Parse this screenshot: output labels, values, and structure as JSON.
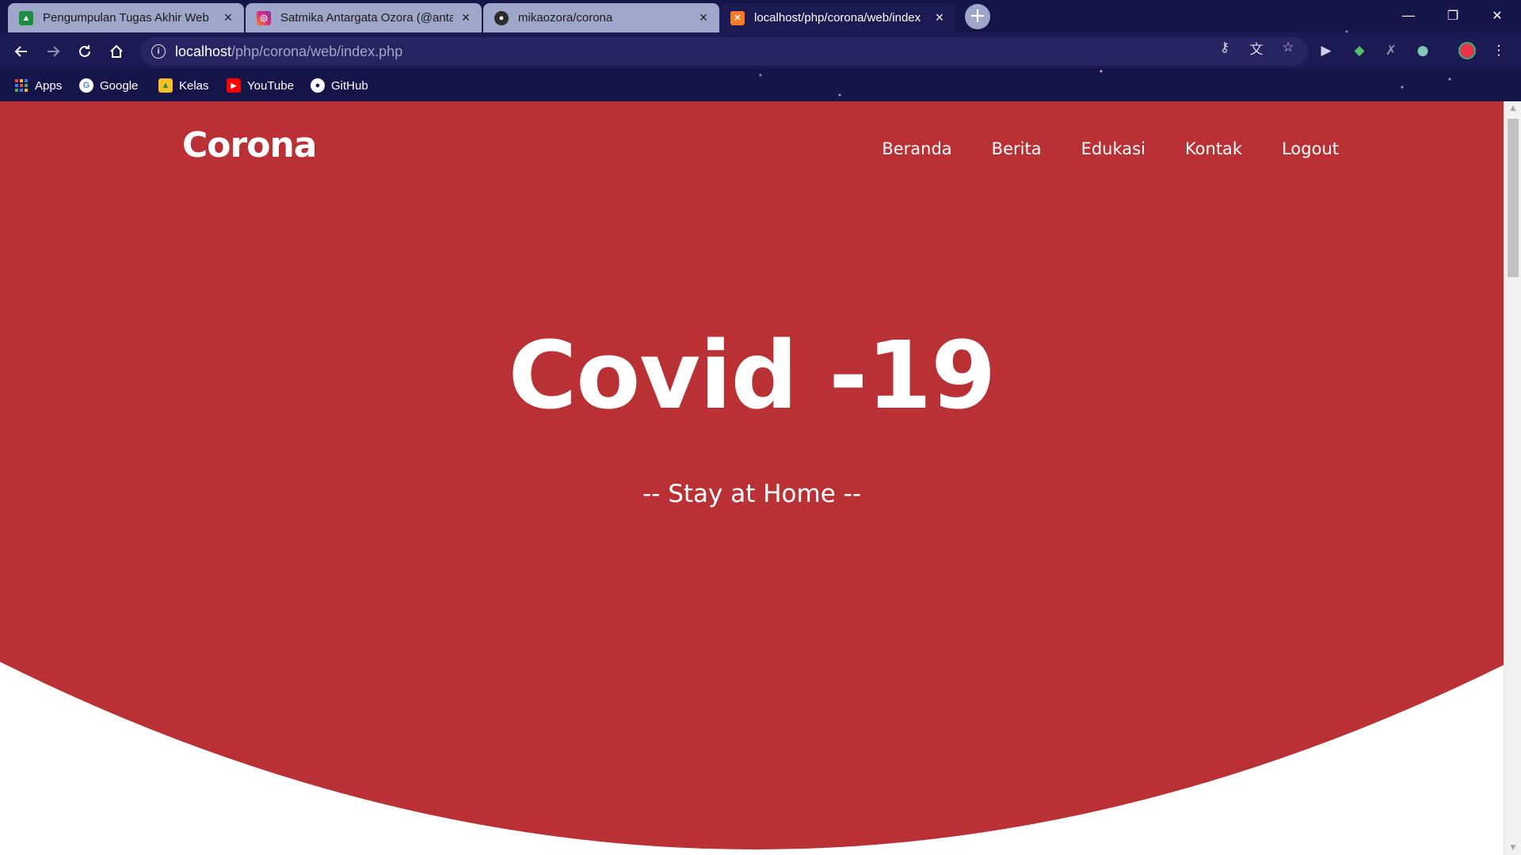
{
  "browser": {
    "tabs": [
      {
        "title": "Pengumpulan Tugas Akhir Web",
        "favicon": "classroom-icon",
        "active": false
      },
      {
        "title": "Satmika Antargata Ozora (@anta",
        "favicon": "instagram-icon",
        "active": false
      },
      {
        "title": "mikaozora/corona",
        "favicon": "github-icon",
        "active": false
      },
      {
        "title": "localhost/php/corona/web/index",
        "favicon": "xampp-icon",
        "active": true
      }
    ],
    "address": {
      "host": "localhost",
      "path": "/php/corona/web/index.php"
    },
    "bookmarks": [
      {
        "label": "Apps",
        "icon": "apps-grid-icon"
      },
      {
        "label": "Google",
        "icon": "google-icon"
      },
      {
        "label": "Kelas",
        "icon": "classroom-icon"
      },
      {
        "label": "YouTube",
        "icon": "youtube-icon"
      },
      {
        "label": "GitHub",
        "icon": "github-icon"
      }
    ],
    "colors": {
      "frame": "#16154a",
      "active_tab": "#1b1a52",
      "inactive_tab": "#9ea7c9"
    }
  },
  "site": {
    "brand": "Corona",
    "nav": [
      "Beranda",
      "Berita",
      "Edukasi",
      "Kontak",
      "Logout"
    ],
    "hero": {
      "title": "Covid -19",
      "subtitle": "-- Stay at Home --"
    },
    "colors": {
      "hero_red": "#b93134",
      "text": "#ffffff",
      "page_bg": "#ffffff"
    }
  }
}
